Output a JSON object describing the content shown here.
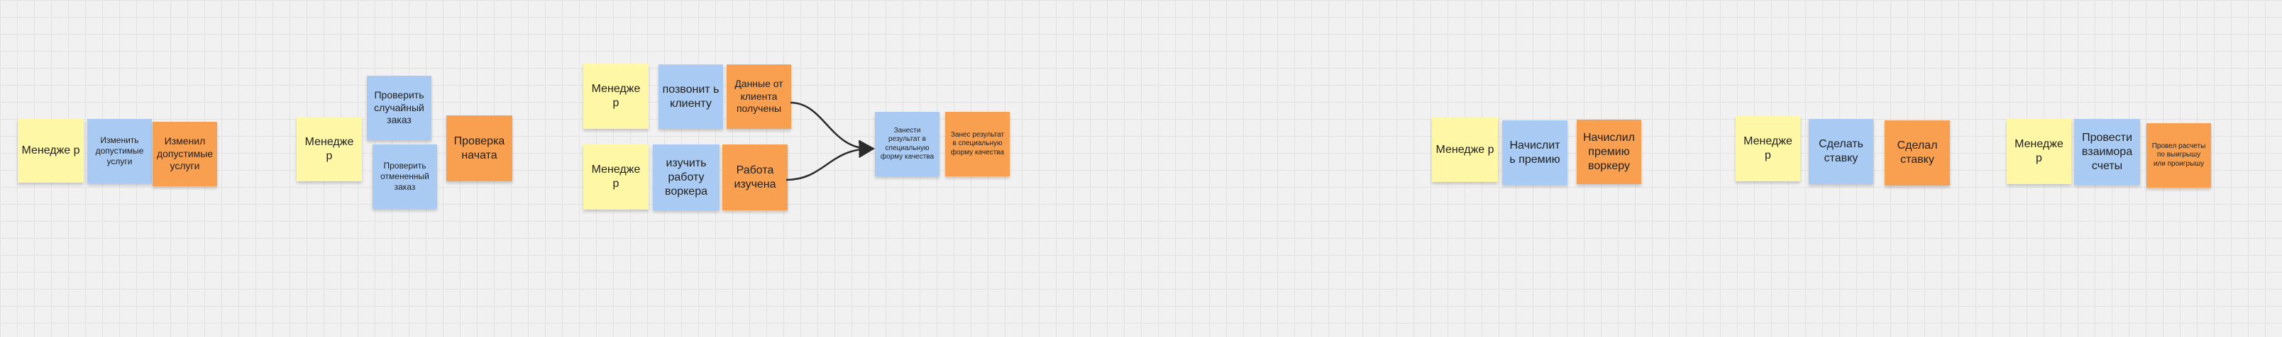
{
  "notes": {
    "g1_role": "Менедже р",
    "g1_action": "Изменить допустимые услуги",
    "g1_event": "Изменил допустимые услуги",
    "g2_role": "Менедже р",
    "g2_action1": "Проверить случайный заказ",
    "g2_action2": "Проверить отмененный заказ",
    "g2_event": "Проверка начата",
    "g3_role1": "Менедже р",
    "g3_action1": "позвонит ь клиенту",
    "g3_event1": "Данные от клиента получены",
    "g3_role2": "Менедже р",
    "g3_action2": "изучить работу воркера",
    "g3_event2": "Работа изучена",
    "g3_action3": "Занести результат в специальную форму качества",
    "g3_event3": "Занес результат в специальную форму качества",
    "g4_role": "Менедже р",
    "g4_action": "Начислит ь премию",
    "g4_event": "Начислил премию воркеру",
    "g5_role": "Менедже р",
    "g5_action": "Сделать ставку",
    "g5_event": "Сделал ставку",
    "g6_role": "Менедже р",
    "g6_action": "Провести взаимора счеты",
    "g6_event": "Провел расчеты по выигрышу или проигрышу"
  },
  "colors": {
    "role": "#fdf7a6",
    "action": "#a9cbf3",
    "event": "#f8a04f",
    "arrow": "#2b2b2b"
  }
}
